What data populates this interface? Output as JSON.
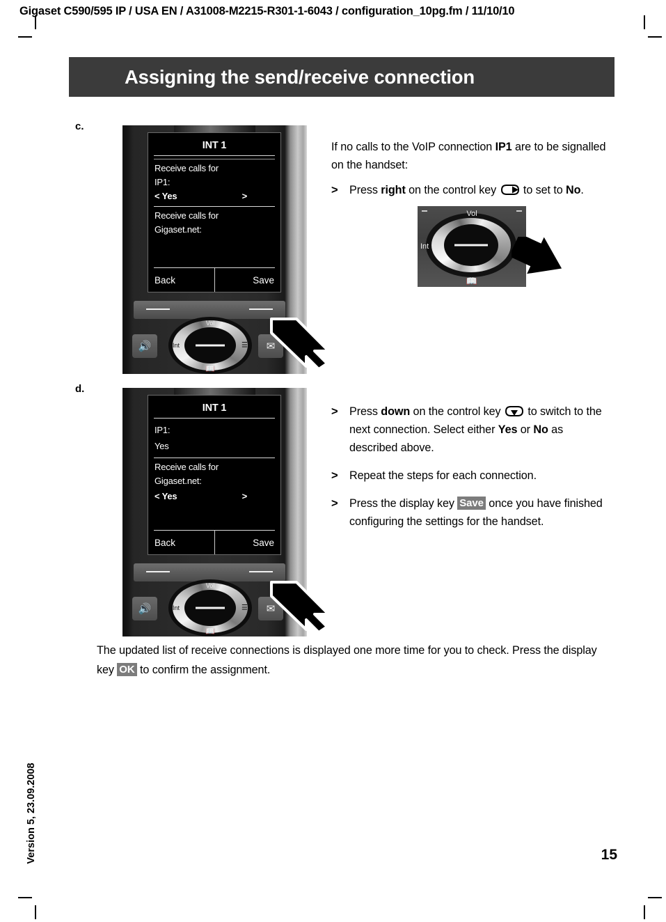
{
  "document": {
    "header": "Gigaset C590/595 IP / USA EN / A31008-M2215-R301-1-6043 / configuration_10pg.fm / 11/10/10",
    "version_side": "Version 5, 23.09.2008",
    "page_number": "15",
    "chapter_title": "Assigning the send/receive connection"
  },
  "steps": {
    "c": {
      "letter": "c.",
      "phone_display": {
        "title": "INT 1",
        "line1": "Receive calls for",
        "line2": "IP1:",
        "selected_prefix": "<",
        "selected_value": "Yes",
        "selected_suffix": ">",
        "line3": "Receive calls for",
        "line4": "Gigaset.net:",
        "softkey_left": "Back",
        "softkey_right": "Save"
      },
      "text_intro_a": "If no calls to the VoIP connection ",
      "text_intro_bold": "IP1",
      "text_intro_b": " are to be signalled on the handset:",
      "bullet": {
        "marker": ">",
        "part1": "Press ",
        "bold1": "right",
        "part2": " on the control key ",
        "icon": "control-key-right-icon",
        "part3": " to set to ",
        "bold2": "No",
        "part4": "."
      },
      "control_key_photo": {
        "vol_label": "Vol",
        "int_label": "Int",
        "book_icon": "phonebook-icon",
        "menu_icon": "menu-icon"
      }
    },
    "d": {
      "letter": "d.",
      "phone_display": {
        "title": "INT 1",
        "line1": "IP1:",
        "line2": "Yes",
        "line3": "Receive calls for",
        "line4": "Gigaset.net:",
        "selected_prefix": "<",
        "selected_value": "Yes",
        "selected_suffix": ">",
        "softkey_left": "Back",
        "softkey_right": "Save"
      },
      "bullets": [
        {
          "marker": ">",
          "part1": "Press ",
          "bold1": "down",
          "part2": " on the control key ",
          "icon": "control-key-down-icon",
          "part3": " to switch to the next connection. Select either ",
          "bold2": "Yes",
          "part4": " or ",
          "bold3": "No",
          "part5": " as described above."
        },
        {
          "marker": ">",
          "part1": "Repeat the steps for each connection."
        },
        {
          "marker": ">",
          "part1": "Press the display key ",
          "chip": "Save",
          "part2": " once you have finished configuring the settings for the handset."
        }
      ]
    }
  },
  "closing": {
    "part1": "The updated list of receive connections is displayed one more time for you to check. Press the display key ",
    "chip": "OK",
    "part2": " to confirm the assignment."
  },
  "phone_hardware": {
    "vol_label": "Vol",
    "int_label": "Int",
    "speaker_icon": "speaker-icon",
    "message_icon": "message-key-icon",
    "menu_icon": "menu-icon",
    "book_icon": "phonebook-icon"
  },
  "colors": {
    "title_bar_bg": "#3b3b3b",
    "chip_bg": "#7c7c7c",
    "lcd_bg": "#000000",
    "phone_body": "#2a2a2a"
  }
}
